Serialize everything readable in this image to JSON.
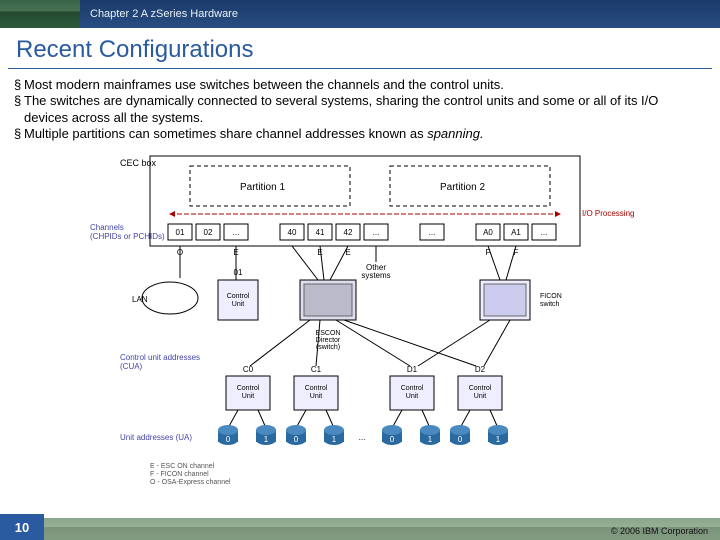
{
  "header": {
    "chapter": "Chapter 2 A zSeries Hardware"
  },
  "title": "Recent Configurations",
  "bullets": [
    "Most modern mainframes use switches between the channels and the control units.",
    "The switches are dynamically connected to several systems, sharing the control units and some or all of its I/O devices across all the systems.",
    "Multiple partitions can sometimes share channel addresses known as "
  ],
  "spanning_word": "spanning.",
  "diagram": {
    "cec_label": "CEC box",
    "partitions": [
      "Partition 1",
      "Partition 2"
    ],
    "io_label": "I/O Processing",
    "channels_label": "Channels\n(CHPIDs or PCHIDs)",
    "channel_ids": [
      "01",
      "02",
      "...",
      "40",
      "41",
      "42",
      "...",
      "...",
      "A0",
      "A1",
      "..."
    ],
    "channel_types": [
      "O",
      "",
      "E",
      "",
      "E",
      "E",
      "",
      "",
      "F",
      "F"
    ],
    "other_systems": "Other\nsystems",
    "lan_label": "LAN",
    "cu_top": {
      "id": "01",
      "label": "Control\nUnit"
    },
    "escon": "ESCON\nDirector\n(switch)",
    "ficon": "FICON\nswitch",
    "cua_label": "Control unit addresses\n(CUA)",
    "control_units": [
      {
        "id": "C0",
        "label": "Control\nUnit"
      },
      {
        "id": "C1",
        "label": "Control\nUnit"
      },
      {
        "id": "D1",
        "label": "Control\nUnit"
      },
      {
        "id": "D2",
        "label": "Control\nUnit"
      }
    ],
    "ua_label": "Unit addresses (UA)",
    "ua_values": [
      "0",
      "1",
      "0",
      "1",
      "...",
      "0",
      "1",
      "0",
      "1"
    ],
    "legend": [
      "E - ESC ON channel",
      "F - FICON channel",
      "O - OSA-Express channel"
    ]
  },
  "footer": {
    "page": "10",
    "copyright": "© 2006 IBM Corporation"
  }
}
